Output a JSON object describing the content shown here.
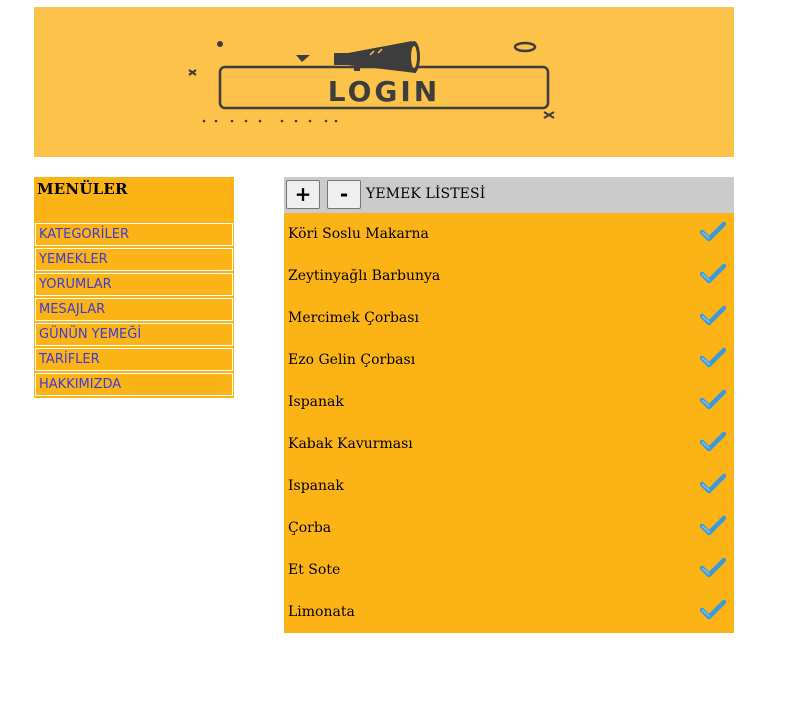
{
  "banner": {
    "logo_text": "LOGIN",
    "background_color": "#fdc24a"
  },
  "sidebar": {
    "title": "MENÜLER",
    "items": [
      {
        "label": "KATEGORİLER"
      },
      {
        "label": "YEMEKLER"
      },
      {
        "label": "YORUMLAR"
      },
      {
        "label": "MESAJLAR"
      },
      {
        "label": "GÜNÜN YEMEĞİ"
      },
      {
        "label": "TARİFLER"
      },
      {
        "label": "HAKKIMIZDA"
      }
    ]
  },
  "main": {
    "add_label": "+",
    "remove_label": "-",
    "title": "YEMEK LİSTESİ",
    "items": [
      {
        "name": "Köri Soslu Makarna",
        "icon": "checkmark-icon"
      },
      {
        "name": "Zeytinyağlı Barbunya",
        "icon": "checkmark-icon"
      },
      {
        "name": "Mercimek Çorbası",
        "icon": "checkmark-icon"
      },
      {
        "name": "Ezo Gelin Çorbası",
        "icon": "checkmark-icon"
      },
      {
        "name": "Ispanak",
        "icon": "checkmark-icon"
      },
      {
        "name": "Kabak Kavurması",
        "icon": "checkmark-icon"
      },
      {
        "name": "Ispanak",
        "icon": "checkmark-icon"
      },
      {
        "name": "Çorba",
        "icon": "checkmark-icon"
      },
      {
        "name": "Et Sote",
        "icon": "checkmark-icon"
      },
      {
        "name": "Limonata",
        "icon": "checkmark-icon"
      }
    ]
  },
  "colors": {
    "panel": "#fcb316",
    "toolbar": "#cbcbcb",
    "link": "#3b3bd6",
    "check": "#3a9ad9"
  }
}
